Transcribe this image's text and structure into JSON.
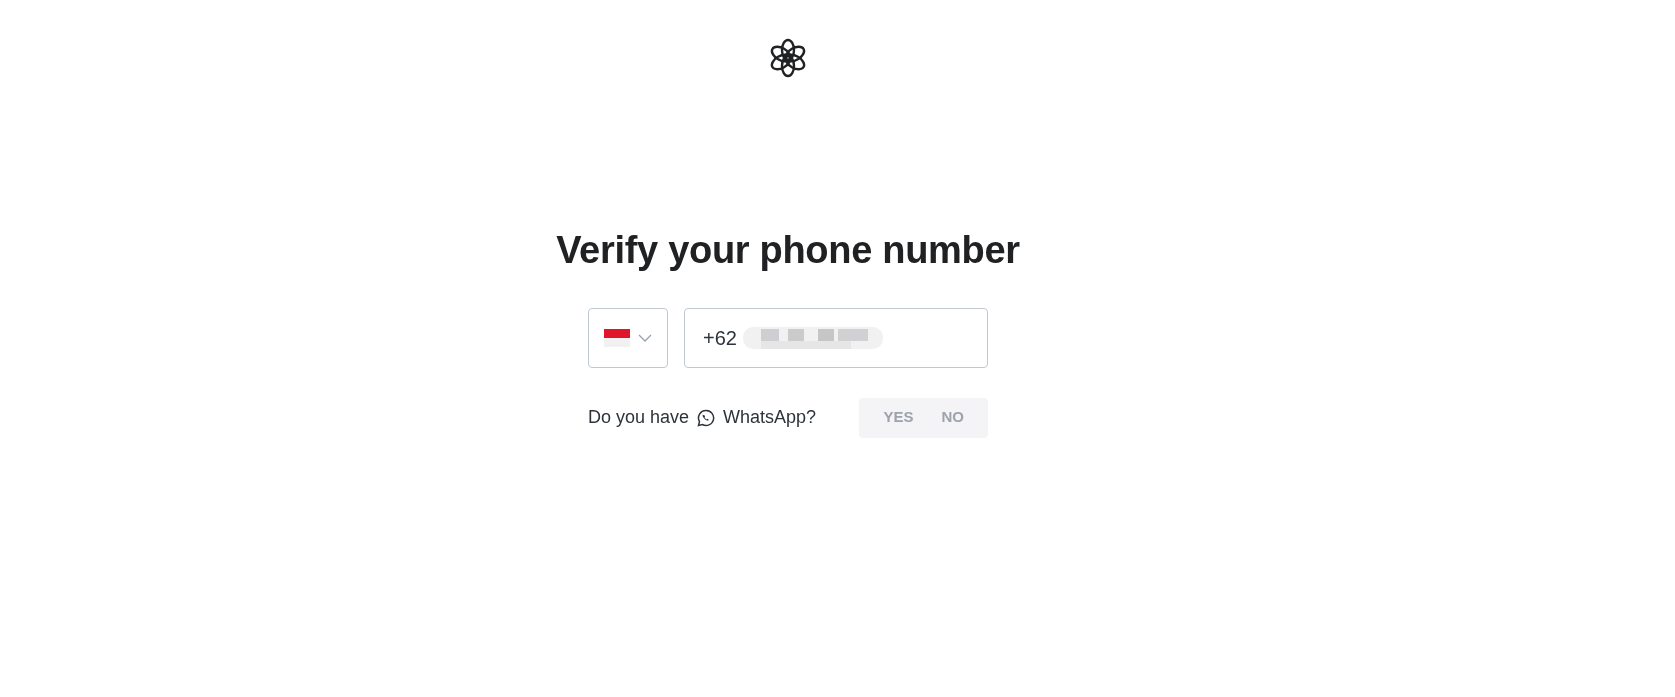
{
  "title": "Verify your phone number",
  "phone": {
    "value": "+62"
  },
  "whatsapp": {
    "prompt": "Do you have",
    "label": "WhatsApp?",
    "options": [
      "YES",
      "NO"
    ]
  }
}
